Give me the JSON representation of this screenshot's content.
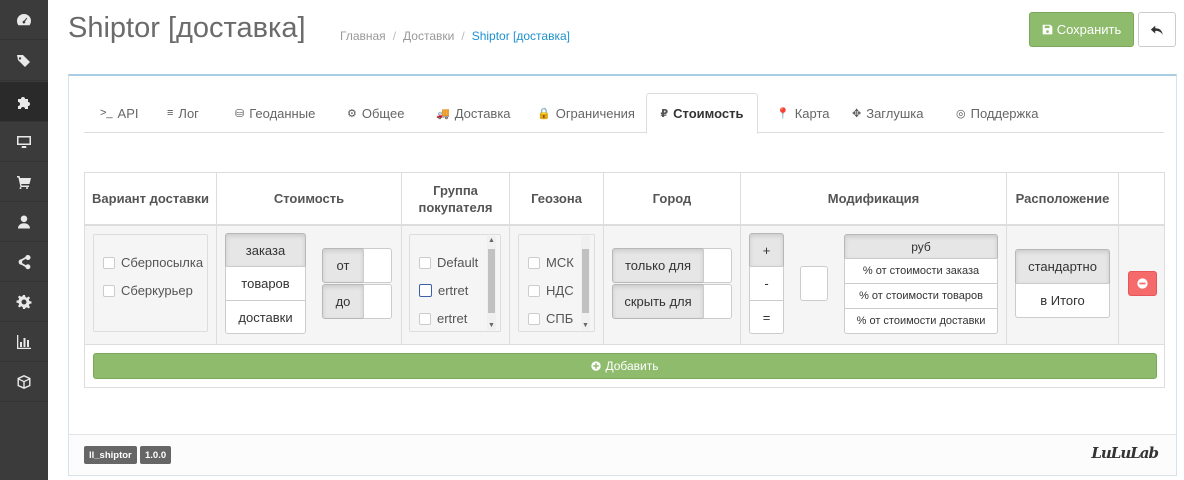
{
  "header": {
    "title": "Shiptor [доставка]",
    "breadcrumb": [
      "Главная",
      "Доставки",
      "Shiptor [доставка]"
    ],
    "save_label": "Сохранить"
  },
  "sidebar": {
    "items": [
      {
        "icon": "dashboard-icon"
      },
      {
        "icon": "tags-icon"
      },
      {
        "icon": "puzzle-icon",
        "active": true
      },
      {
        "icon": "desktop-icon"
      },
      {
        "icon": "cart-icon"
      },
      {
        "icon": "user-icon"
      },
      {
        "icon": "share-icon"
      },
      {
        "icon": "gear-icon"
      },
      {
        "icon": "bar-chart-icon"
      },
      {
        "icon": "cube-icon"
      }
    ]
  },
  "tabs": [
    {
      "icon": ">_",
      "label": "API"
    },
    {
      "icon": "≡",
      "label": "Лог"
    },
    {
      "icon": "⛁",
      "label": "Геоданные"
    },
    {
      "icon": "⚙",
      "label": "Общее"
    },
    {
      "icon": "🚚",
      "label": "Доставка"
    },
    {
      "icon": "🔒",
      "label": "Ограничения"
    },
    {
      "icon": "₽",
      "label": "Стоимость",
      "active": true
    },
    {
      "icon": "📍",
      "label": "Карта"
    },
    {
      "icon": "✥",
      "label": "Заглушка"
    },
    {
      "icon": "◎",
      "label": "Поддержка"
    }
  ],
  "table": {
    "headers": {
      "variant": "Вариант доставки",
      "cost": "Стоимость",
      "group": "Группа покупателя",
      "geozone": "Геозона",
      "city": "Город",
      "modification": "Модификация",
      "placement": "Расположение"
    },
    "row": {
      "variants": [
        "Сберпосылка",
        "Сберкурьер"
      ],
      "cost_base": [
        "заказа",
        "товаров",
        "доставки"
      ],
      "cost_range": [
        "от",
        "до"
      ],
      "groups": [
        "Default",
        "ertret",
        "ertret"
      ],
      "geozones": [
        "МСК",
        "НДС",
        "СПБ"
      ],
      "city_modes": [
        "только для",
        "скрыть для"
      ],
      "ops": [
        "+",
        "-",
        "="
      ],
      "units": [
        "руб",
        "% от стоимости заказа",
        "% от стоимости товаров",
        "% от стоимости доставки"
      ],
      "placement": [
        "стандартно",
        "в Итого"
      ]
    },
    "add_label": "Добавить"
  },
  "footer": {
    "module_badge": "ll_shiptor",
    "version_badge": "1.0.0",
    "logo": "LuLuLab"
  },
  "colors": {
    "accent_green": "#8fbb6c",
    "danger": "#f56b6b",
    "link": "#1e91cf",
    "sidebar": "#3b3b3b"
  }
}
